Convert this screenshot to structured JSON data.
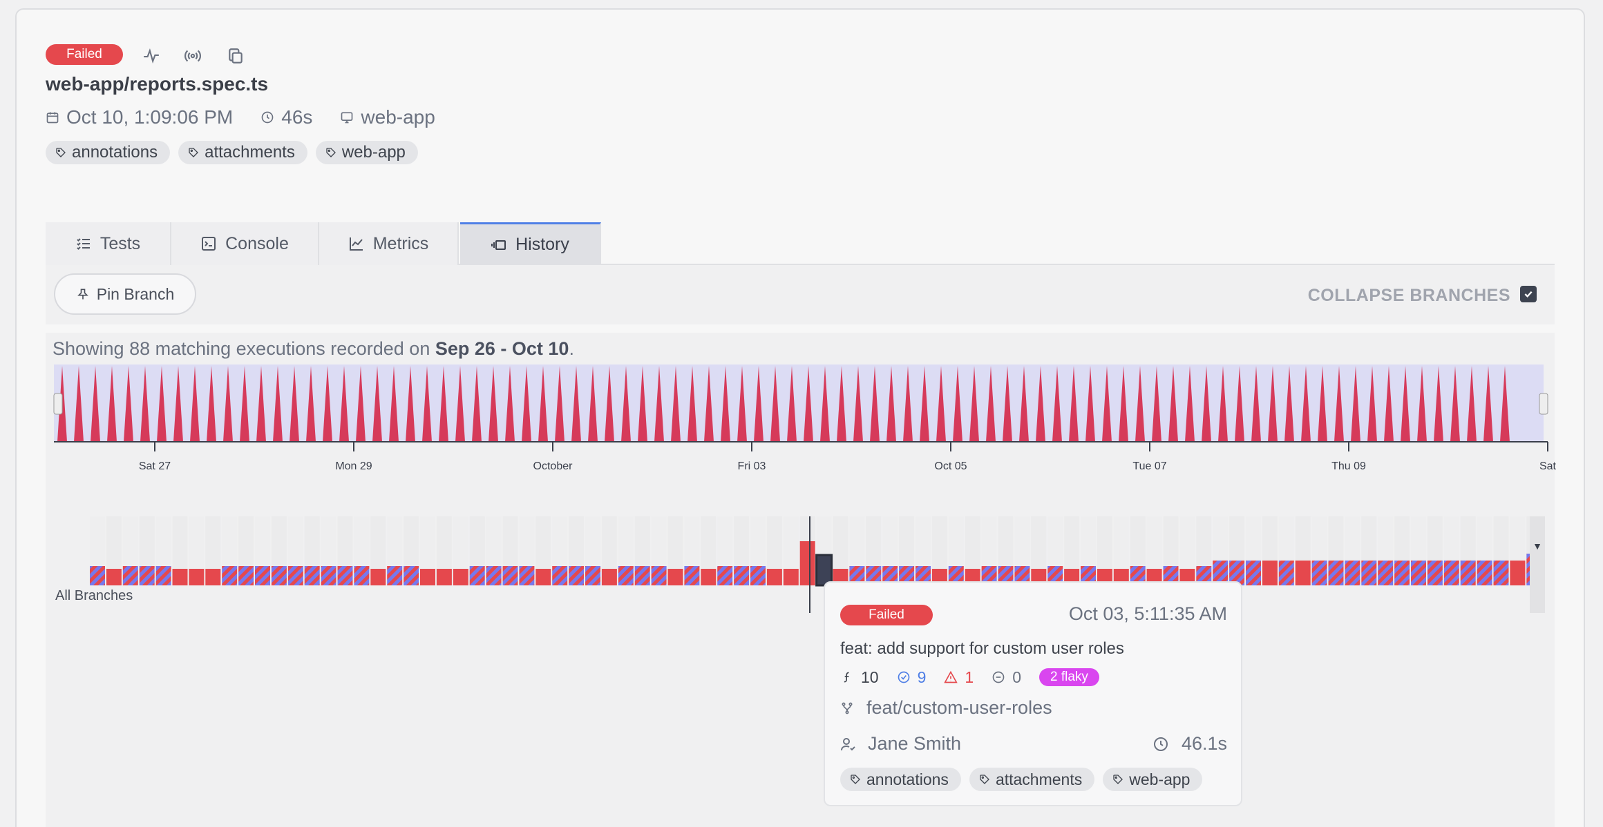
{
  "header": {
    "status": "Failed",
    "file_title": "web-app/reports.spec.ts",
    "date": "Oct 10, 1:09:06 PM",
    "duration": "46s",
    "environment": "web-app",
    "tags": [
      "annotations",
      "attachments",
      "web-app"
    ]
  },
  "tabs": [
    {
      "label": "Tests",
      "icon": "list-check-icon"
    },
    {
      "label": "Console",
      "icon": "terminal-icon"
    },
    {
      "label": "Metrics",
      "icon": "line-chart-icon"
    },
    {
      "label": "History",
      "icon": "history-icon",
      "active": true
    }
  ],
  "toolbar": {
    "pin_label": "Pin Branch",
    "collapse_label": "COLLAPSE BRANCHES",
    "collapse_checked": true
  },
  "history": {
    "summary_prefix": "Showing 88 matching executions recorded on ",
    "summary_range": "Sep 26 - Oct 10",
    "summary_suffix": ".",
    "timeline_ticks": [
      "Sat 27",
      "Mon 29",
      "October",
      "Fri 03",
      "Oct 05",
      "Tue 07",
      "Thu 09",
      "Sat"
    ],
    "branch_label": "All Branches",
    "selected_execution_index": 44
  },
  "colors": {
    "failed": "#e5484d",
    "flaky_stripe": "#7678ee",
    "spike": "#d63a5a",
    "flaky_badge": "#d946ef",
    "passed_count": "#4f7fe6"
  },
  "tooltip": {
    "status": "Failed",
    "date": "Oct 03, 5:11:35 AM",
    "message": "feat: add support for custom user roles",
    "total": "10",
    "passed": "9",
    "failed": "1",
    "skipped": "0",
    "flaky": "2 flaky",
    "branch": "feat/custom-user-roles",
    "author": "Jane Smith",
    "duration": "46.1s",
    "tags": [
      "annotations",
      "attachments",
      "web-app"
    ]
  }
}
